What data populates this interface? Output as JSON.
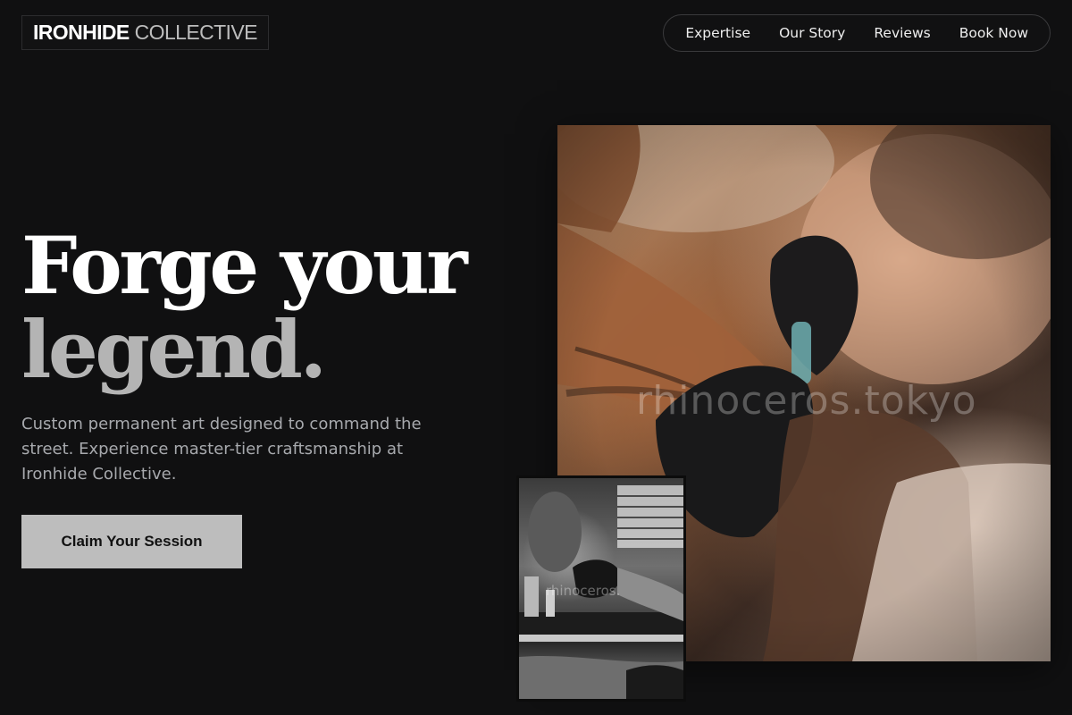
{
  "brand": {
    "name_strong": "IRONHIDE",
    "name_light": "COLLECTIVE"
  },
  "nav": {
    "items": [
      {
        "label": "Expertise"
      },
      {
        "label": "Our Story"
      },
      {
        "label": "Reviews"
      },
      {
        "label": "Book Now"
      }
    ]
  },
  "hero": {
    "headline_line1": "Forge your",
    "headline_line2": "legend.",
    "subcopy": "Custom permanent art designed to command the street. Experience master-tier craftsmanship at Ironhide Collective.",
    "cta_label": "Claim Your Session"
  },
  "media": {
    "main_watermark": "rhinoceros.tokyo",
    "inset_watermark": "rhinoceros."
  },
  "colors": {
    "background": "#101011",
    "cta_background": "#bdbdbd",
    "headline_secondary": "#b4b4b4"
  }
}
